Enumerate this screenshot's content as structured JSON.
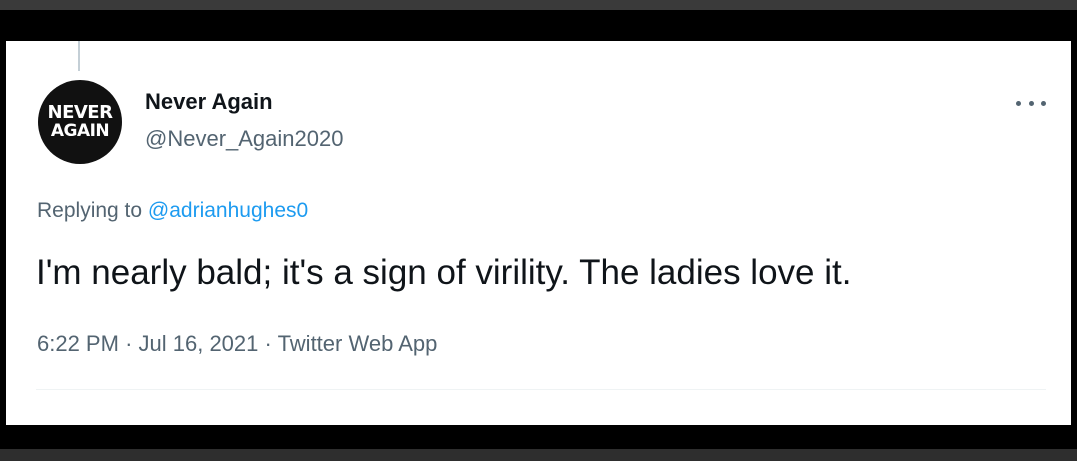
{
  "tweet": {
    "author": {
      "display_name": "Never Again",
      "handle": "@Never_Again2020",
      "avatar_text_line1": "NEVER",
      "avatar_text_line2": "AGAIN"
    },
    "more_icon": "more-horizontal-icon",
    "reply_prefix": "Replying to",
    "reply_to": "@adrianhughes0",
    "text": "I'm nearly bald; it's a sign of virility. The ladies love it.",
    "time": "6:22 PM",
    "separator": "·",
    "date": "Jul 16, 2021",
    "source": "Twitter Web App"
  },
  "colors": {
    "text_primary": "#0f1419",
    "text_secondary": "#536471",
    "link": "#1d9bf0",
    "background": "#ffffff"
  }
}
